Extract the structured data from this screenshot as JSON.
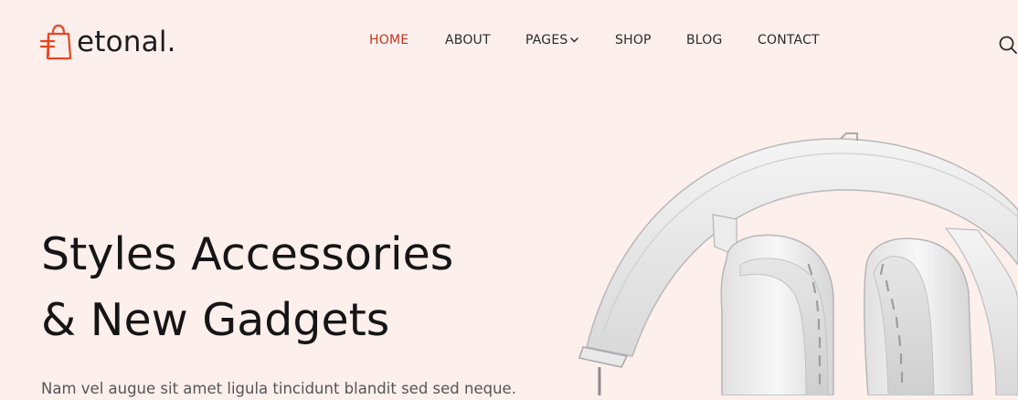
{
  "brand": {
    "name": "etonal.",
    "icon": "shopping-bag-icon",
    "accent_color": "#e8461f"
  },
  "nav": {
    "items": [
      {
        "label": "HOME",
        "active": true
      },
      {
        "label": "ABOUT",
        "active": false
      },
      {
        "label": "PAGES",
        "active": false,
        "has_dropdown": true
      },
      {
        "label": "SHOP",
        "active": false
      },
      {
        "label": "BLOG",
        "active": false
      },
      {
        "label": "CONTACT",
        "active": false
      }
    ],
    "active_color": "#c4361d",
    "text_color": "#2b2b2b"
  },
  "search": {
    "icon": "search-icon"
  },
  "hero": {
    "title_line1": "Styles Accessories",
    "title_line2": "& New Gadgets",
    "description": "Nam vel augue sit amet ligula tincidunt blandit sed sed neque.",
    "background_color": "#fdefec",
    "image": "white-headphones"
  }
}
